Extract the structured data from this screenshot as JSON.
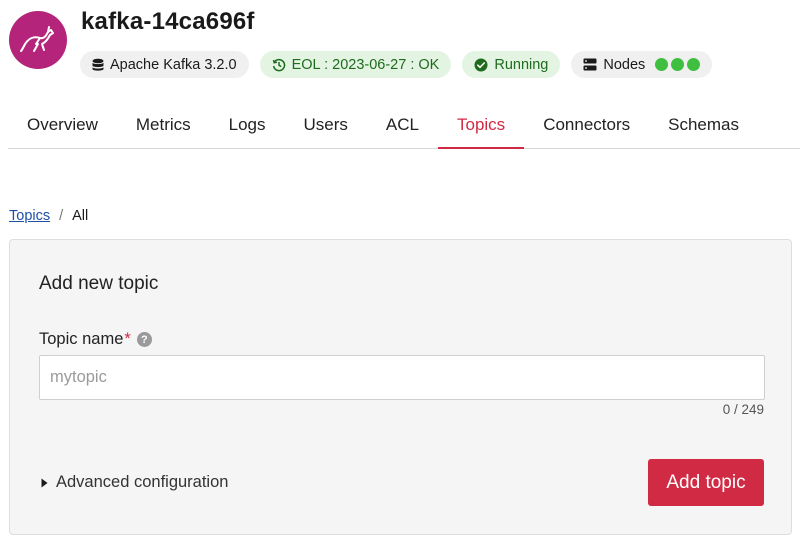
{
  "service": {
    "title": "kafka-14ca696f",
    "logo_icon": "kafka-logo-icon",
    "brand_color": "#b4247a"
  },
  "chips": {
    "version": "Apache Kafka 3.2.0",
    "eol": "EOL : 2023-06-27 : OK",
    "status": "Running",
    "nodes_label": "Nodes",
    "nodes_count": 3,
    "node_color": "#3fbf3f"
  },
  "tabs": [
    {
      "label": "Overview",
      "active": false
    },
    {
      "label": "Metrics",
      "active": false
    },
    {
      "label": "Logs",
      "active": false
    },
    {
      "label": "Users",
      "active": false
    },
    {
      "label": "ACL",
      "active": false
    },
    {
      "label": "Topics",
      "active": true
    },
    {
      "label": "Connectors",
      "active": false
    },
    {
      "label": "Schemas",
      "active": false
    }
  ],
  "breadcrumb": {
    "link": "Topics",
    "separator": "/",
    "current": "All"
  },
  "form": {
    "title": "Add new topic",
    "field_label": "Topic name",
    "required_mark": "*",
    "help_glyph": "?",
    "input_value": "",
    "input_placeholder": "mytopic",
    "counter": "0 / 249",
    "advanced_label": "Advanced configuration",
    "submit_label": "Add topic"
  },
  "colors": {
    "accent": "#d12a44",
    "chip_green_bg": "#e3f4e2",
    "chip_green_text": "#1e6b1e"
  }
}
